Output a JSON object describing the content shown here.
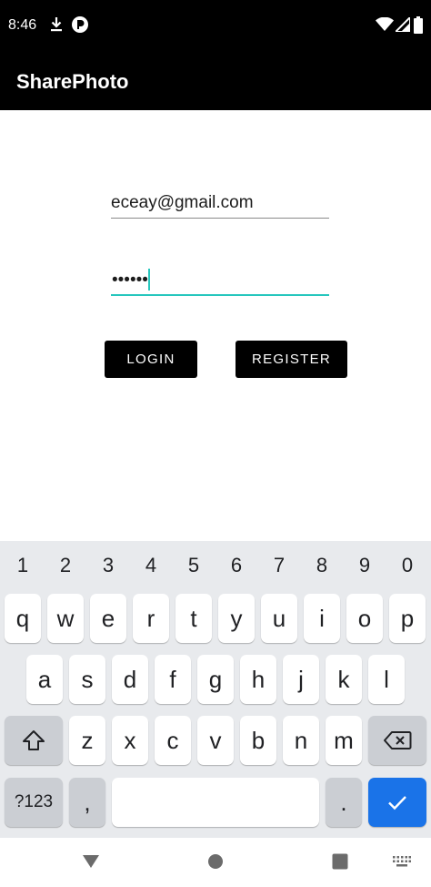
{
  "status_bar": {
    "time": "8:46"
  },
  "app_bar": {
    "title": "SharePhoto"
  },
  "form": {
    "email_value": "eceay@gmail.com",
    "password_mask": "••••••"
  },
  "buttons": {
    "login": "LOGIN",
    "register": "REGISTER"
  },
  "keyboard": {
    "numbers": [
      "1",
      "2",
      "3",
      "4",
      "5",
      "6",
      "7",
      "8",
      "9",
      "0"
    ],
    "row1": [
      "q",
      "w",
      "e",
      "r",
      "t",
      "y",
      "u",
      "i",
      "o",
      "p"
    ],
    "row2": [
      "a",
      "s",
      "d",
      "f",
      "g",
      "h",
      "j",
      "k",
      "l"
    ],
    "row3": [
      "z",
      "x",
      "c",
      "v",
      "b",
      "n",
      "m"
    ],
    "symbols_label": "?123",
    "comma": ",",
    "period": "."
  },
  "colors": {
    "accent": "#26c6bd",
    "enter_key": "#1a73e8",
    "bar": "#000000"
  },
  "icons": [
    "download-icon",
    "app-notification-icon",
    "wifi-icon",
    "signal-icon",
    "battery-icon",
    "shift-icon",
    "backspace-icon",
    "checkmark-icon",
    "nav-back-icon",
    "nav-home-icon",
    "nav-recents-icon",
    "keyboard-switch-icon"
  ]
}
